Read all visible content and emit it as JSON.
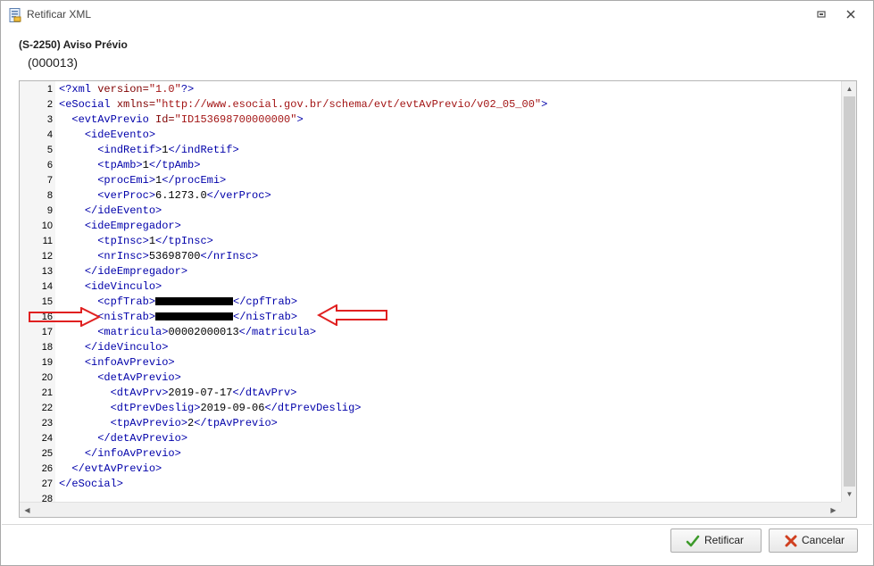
{
  "window": {
    "title": "Retificar XML"
  },
  "header": {
    "event_title": "(S-2250) Aviso Prévio",
    "event_sub": "(000013)"
  },
  "editor": {
    "lines": [
      {
        "n": "1",
        "tokens": [
          {
            "t": "tag",
            "v": "<?xml "
          },
          {
            "t": "attr",
            "v": "version="
          },
          {
            "t": "str",
            "v": "\"1.0\""
          },
          {
            "t": "tag",
            "v": "?>"
          }
        ]
      },
      {
        "n": "2",
        "tokens": [
          {
            "t": "tag",
            "v": "<eSocial "
          },
          {
            "t": "attr",
            "v": "xmlns="
          },
          {
            "t": "str",
            "v": "\"http://www.esocial.gov.br/schema/evt/evtAvPrevio/v02_05_00\""
          },
          {
            "t": "tag",
            "v": ">"
          }
        ]
      },
      {
        "n": "3",
        "tokens": [
          {
            "t": "plain",
            "v": "  "
          },
          {
            "t": "tag",
            "v": "<evtAvPrevio "
          },
          {
            "t": "attr",
            "v": "Id="
          },
          {
            "t": "str",
            "v": "\"ID153698700000000\""
          },
          {
            "t": "tag",
            "v": ">"
          }
        ]
      },
      {
        "n": "4",
        "tokens": [
          {
            "t": "plain",
            "v": "    "
          },
          {
            "t": "tag",
            "v": "<ideEvento>"
          }
        ]
      },
      {
        "n": "5",
        "tokens": [
          {
            "t": "plain",
            "v": "      "
          },
          {
            "t": "tag",
            "v": "<indRetif>"
          },
          {
            "t": "plain",
            "v": "1"
          },
          {
            "t": "tag",
            "v": "</indRetif>"
          }
        ]
      },
      {
        "n": "6",
        "tokens": [
          {
            "t": "plain",
            "v": "      "
          },
          {
            "t": "tag",
            "v": "<tpAmb>"
          },
          {
            "t": "plain",
            "v": "1"
          },
          {
            "t": "tag",
            "v": "</tpAmb>"
          }
        ]
      },
      {
        "n": "7",
        "tokens": [
          {
            "t": "plain",
            "v": "      "
          },
          {
            "t": "tag",
            "v": "<procEmi>"
          },
          {
            "t": "plain",
            "v": "1"
          },
          {
            "t": "tag",
            "v": "</procEmi>"
          }
        ]
      },
      {
        "n": "8",
        "tokens": [
          {
            "t": "plain",
            "v": "      "
          },
          {
            "t": "tag",
            "v": "<verProc>"
          },
          {
            "t": "plain",
            "v": "6.1273.0"
          },
          {
            "t": "tag",
            "v": "</verProc>"
          }
        ]
      },
      {
        "n": "9",
        "tokens": [
          {
            "t": "plain",
            "v": "    "
          },
          {
            "t": "tag",
            "v": "</ideEvento>"
          }
        ]
      },
      {
        "n": "10",
        "tokens": [
          {
            "t": "plain",
            "v": "    "
          },
          {
            "t": "tag",
            "v": "<ideEmpregador>"
          }
        ]
      },
      {
        "n": "11",
        "tokens": [
          {
            "t": "plain",
            "v": "      "
          },
          {
            "t": "tag",
            "v": "<tpInsc>"
          },
          {
            "t": "plain",
            "v": "1"
          },
          {
            "t": "tag",
            "v": "</tpInsc>"
          }
        ]
      },
      {
        "n": "12",
        "tokens": [
          {
            "t": "plain",
            "v": "      "
          },
          {
            "t": "tag",
            "v": "<nrInsc>"
          },
          {
            "t": "plain",
            "v": "53698700"
          },
          {
            "t": "tag",
            "v": "</nrInsc>"
          }
        ]
      },
      {
        "n": "13",
        "tokens": [
          {
            "t": "plain",
            "v": "    "
          },
          {
            "t": "tag",
            "v": "</ideEmpregador>"
          }
        ]
      },
      {
        "n": "14",
        "tokens": [
          {
            "t": "plain",
            "v": "    "
          },
          {
            "t": "tag",
            "v": "<ideVinculo>"
          }
        ]
      },
      {
        "n": "15",
        "tokens": [
          {
            "t": "plain",
            "v": "      "
          },
          {
            "t": "tag",
            "v": "<cpfTrab>"
          },
          {
            "t": "redact",
            "v": ""
          },
          {
            "t": "tag",
            "v": "</cpfTrab>"
          }
        ]
      },
      {
        "n": "16",
        "tokens": [
          {
            "t": "plain",
            "v": "      "
          },
          {
            "t": "tag",
            "v": "<nisTrab>"
          },
          {
            "t": "redact",
            "v": ""
          },
          {
            "t": "tag",
            "v": "</nisTrab>"
          }
        ]
      },
      {
        "n": "17",
        "tokens": [
          {
            "t": "plain",
            "v": "      "
          },
          {
            "t": "tag",
            "v": "<matricula>"
          },
          {
            "t": "plain",
            "v": "00002000013"
          },
          {
            "t": "tag",
            "v": "</matricula>"
          }
        ]
      },
      {
        "n": "18",
        "tokens": [
          {
            "t": "plain",
            "v": "    "
          },
          {
            "t": "tag",
            "v": "</ideVinculo>"
          }
        ]
      },
      {
        "n": "19",
        "tokens": [
          {
            "t": "plain",
            "v": "    "
          },
          {
            "t": "tag",
            "v": "<infoAvPrevio>"
          }
        ]
      },
      {
        "n": "20",
        "tokens": [
          {
            "t": "plain",
            "v": "      "
          },
          {
            "t": "tag",
            "v": "<detAvPrevio>"
          }
        ]
      },
      {
        "n": "21",
        "tokens": [
          {
            "t": "plain",
            "v": "        "
          },
          {
            "t": "tag",
            "v": "<dtAvPrv>"
          },
          {
            "t": "plain",
            "v": "2019-07-17"
          },
          {
            "t": "tag",
            "v": "</dtAvPrv>"
          }
        ]
      },
      {
        "n": "22",
        "tokens": [
          {
            "t": "plain",
            "v": "        "
          },
          {
            "t": "tag",
            "v": "<dtPrevDeslig>"
          },
          {
            "t": "plain",
            "v": "2019-09-06"
          },
          {
            "t": "tag",
            "v": "</dtPrevDeslig>"
          }
        ]
      },
      {
        "n": "23",
        "tokens": [
          {
            "t": "plain",
            "v": "        "
          },
          {
            "t": "tag",
            "v": "<tpAvPrevio>"
          },
          {
            "t": "plain",
            "v": "2"
          },
          {
            "t": "tag",
            "v": "</tpAvPrevio>"
          }
        ]
      },
      {
        "n": "24",
        "tokens": [
          {
            "t": "plain",
            "v": "      "
          },
          {
            "t": "tag",
            "v": "</detAvPrevio>"
          }
        ]
      },
      {
        "n": "25",
        "tokens": [
          {
            "t": "plain",
            "v": "    "
          },
          {
            "t": "tag",
            "v": "</infoAvPrevio>"
          }
        ]
      },
      {
        "n": "26",
        "tokens": [
          {
            "t": "plain",
            "v": "  "
          },
          {
            "t": "tag",
            "v": "</evtAvPrevio>"
          }
        ]
      },
      {
        "n": "27",
        "tokens": [
          {
            "t": "tag",
            "v": "</eSocial>"
          }
        ]
      },
      {
        "n": "28",
        "tokens": []
      }
    ]
  },
  "colors": {
    "tag": "#0000aa",
    "attr": "#800000",
    "string": "#a31515",
    "annotation_arrow": "#e02020"
  },
  "icons": {
    "window": "xml-document-icon",
    "restore": "restore-icon",
    "close": "close-icon",
    "ok": "check-icon",
    "cancel": "x-icon"
  },
  "buttons": {
    "ok_label": "Retificar",
    "cancel_label": "Cancelar"
  }
}
